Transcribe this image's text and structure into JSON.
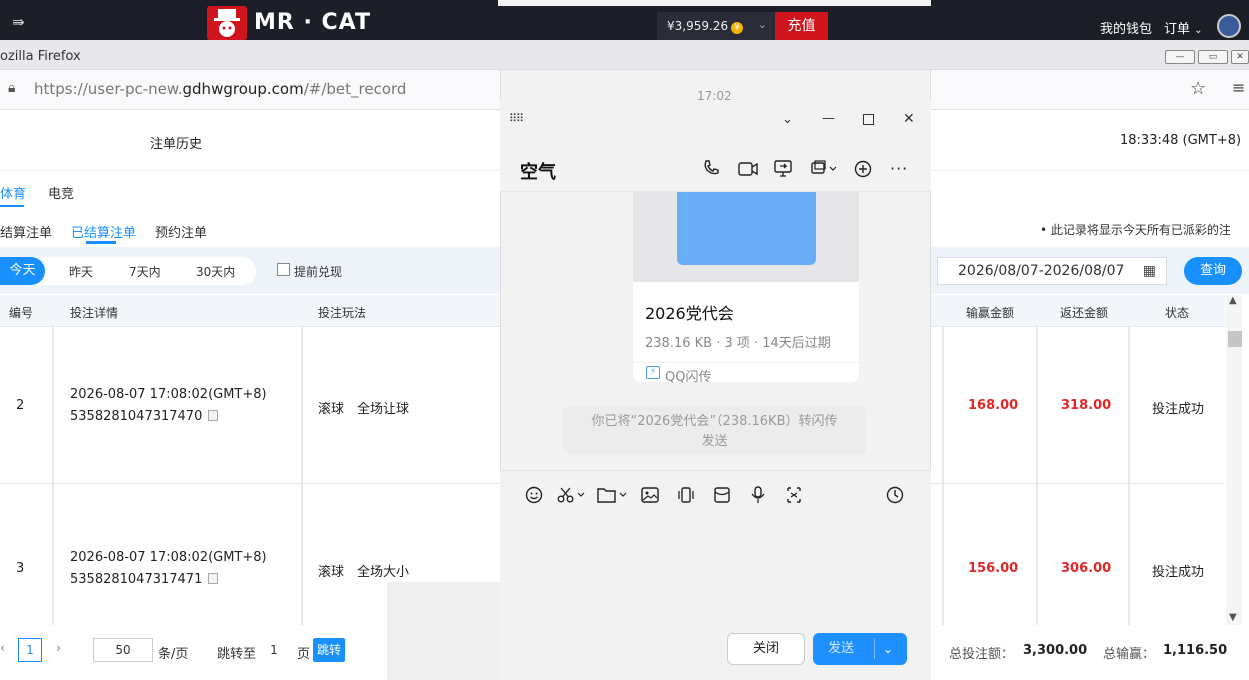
{
  "app": {
    "brand": "MR · CAT",
    "balance": "¥3,959.26",
    "coin": "¥",
    "recharge": "充值",
    "wallet": "我的钱包",
    "orders": "订单"
  },
  "browser": {
    "title": "ozilla Firefox",
    "url_prefix": "https://user-pc-new.",
    "url_domain": "gdhwgroup.com",
    "url_path": "/#/bet_record"
  },
  "page": {
    "title": "注单历史",
    "server_time": "18:33:48 (GMT+8)",
    "tabs": [
      "体育",
      "电竞"
    ],
    "subtabs": [
      "结算注单",
      "已结算注单",
      "预约注单"
    ],
    "notice": "• 此记录将显示今天所有已派彩的注",
    "date_filters": [
      "今天",
      "昨天",
      "7天内",
      "30天内"
    ],
    "early_cashout": "提前兑现",
    "date_range": "2026/08/07-2026/08/07",
    "query": "查询",
    "columns": {
      "no": "编号",
      "detail": "投注详情",
      "play": "投注玩法",
      "win_amount": "输赢金额",
      "return_amount": "返还金额",
      "status": "状态"
    },
    "rows": [
      {
        "no": "2",
        "time": "2026-08-07 17:08:02(GMT+8)",
        "id": "5358281047317470",
        "play": "滚球　全场让球",
        "win": "168.00",
        "ret": "318.00",
        "status": "投注成功"
      },
      {
        "no": "3",
        "time": "2026-08-07 17:08:02(GMT+8)",
        "id": "5358281047317471",
        "play": "滚球　全场大小",
        "win": "156.00",
        "ret": "306.00",
        "status": "投注成功"
      }
    ],
    "pager": {
      "current": "1",
      "size": "50",
      "per_page": "条/页",
      "jump_to": "跳转至",
      "jump_value": "1",
      "page_unit": "页",
      "jump_btn": "跳转"
    },
    "totals": {
      "bet_label": "总投注额：",
      "bet_value": "3,300.00",
      "win_label": "总输赢：",
      "win_value": "1,116.50"
    }
  },
  "qq": {
    "timestamp": "17:02",
    "chat_name": "空气",
    "file": {
      "name": "2026党代会",
      "meta": "238.16 KB · 3 项 · 14天后过期",
      "service": "QQ闪传"
    },
    "system_msg_1": "你已将“2026党代会”（238.16KB）转闪传",
    "system_msg_2": "发送",
    "close": "关闭",
    "send": "发送"
  }
}
